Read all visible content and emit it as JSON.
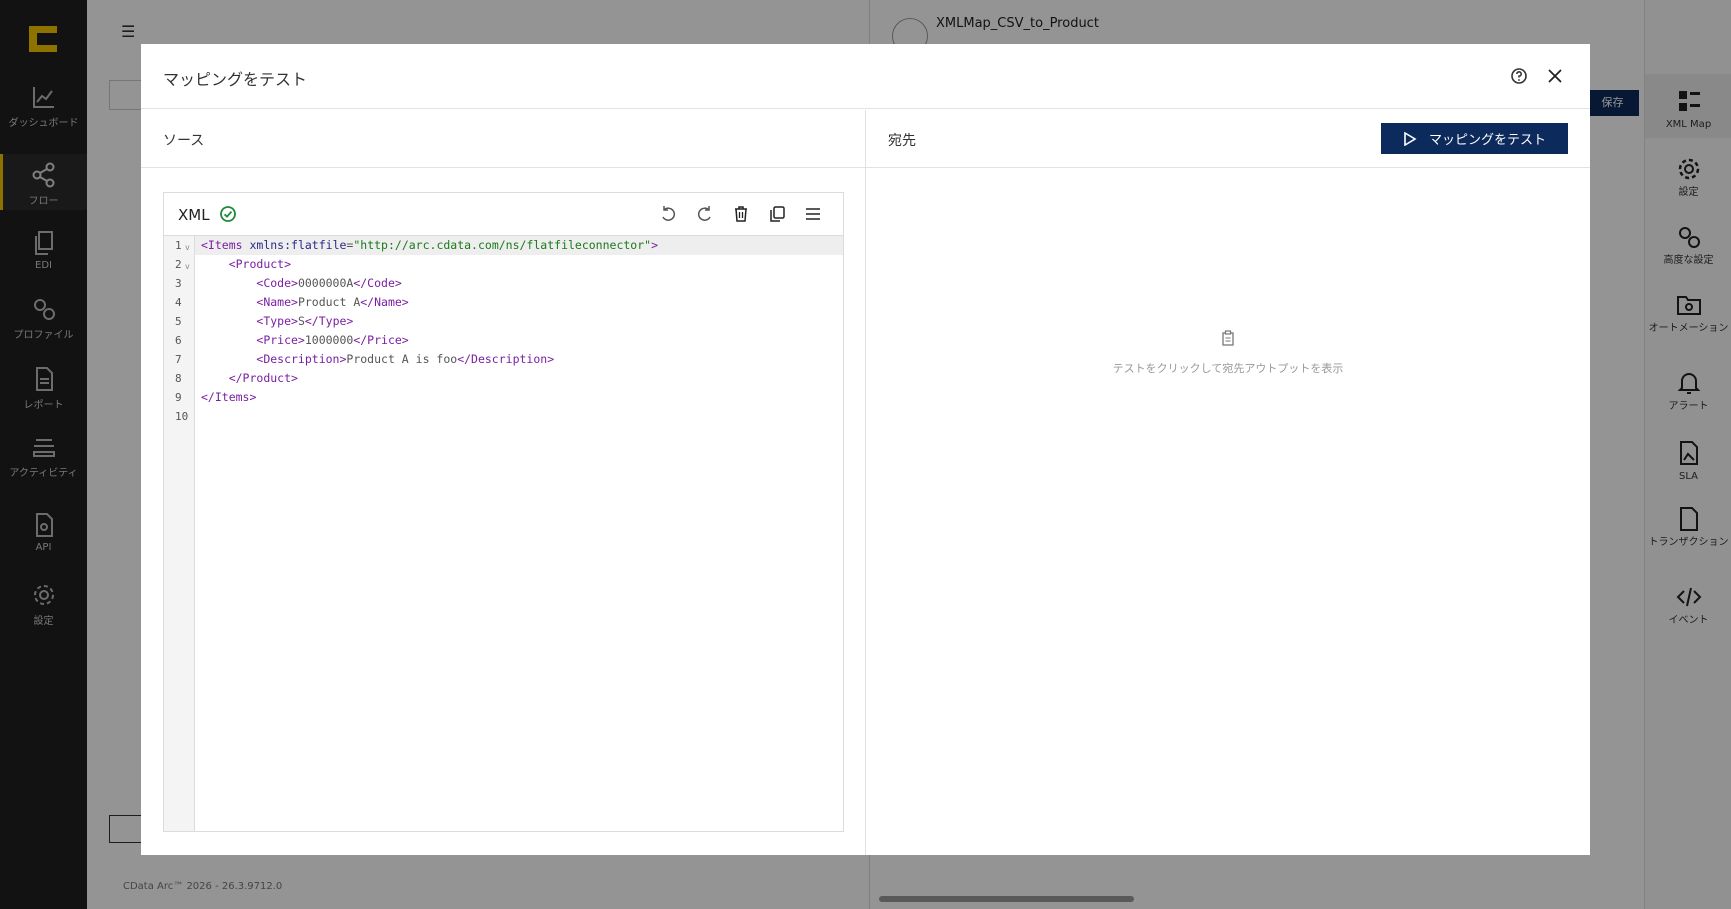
{
  "leftnav": {
    "items": [
      {
        "label": "ダッシュボード",
        "icon": "chart-icon"
      },
      {
        "label": "フロー",
        "icon": "share-icon"
      },
      {
        "label": "EDI",
        "icon": "documents-icon"
      },
      {
        "label": "プロファイル",
        "icon": "gears-icon"
      },
      {
        "label": "レポート",
        "icon": "report-icon"
      },
      {
        "label": "アクティビティ",
        "icon": "stack-icon"
      },
      {
        "label": "API",
        "icon": "api-icon"
      },
      {
        "label": "設定",
        "icon": "gear-icon"
      }
    ]
  },
  "background": {
    "flow_title": "XMLMap_CSV_to_Product",
    "save_label": "保存",
    "footer_version": "CData Arc™ 2026 - 26.3.9712.0"
  },
  "rightrail": {
    "items": [
      {
        "label": "XML Map",
        "icon": "grid-icon"
      },
      {
        "label": "設定",
        "icon": "gear-icon"
      },
      {
        "label": "高度な設定",
        "icon": "gears-icon"
      },
      {
        "label": "オートメーション",
        "icon": "folder-gear-icon"
      },
      {
        "label": "アラート",
        "icon": "bell-icon"
      },
      {
        "label": "SLA",
        "icon": "image-doc-icon"
      },
      {
        "label": "トランザクション",
        "icon": "file-icon"
      },
      {
        "label": "イベント",
        "icon": "code-icon"
      }
    ]
  },
  "modal": {
    "title": "マッピングをテスト",
    "source_label": "ソース",
    "dest_label": "宛先",
    "test_button": "マッピングをテスト",
    "editor": {
      "language": "XML",
      "status": "valid",
      "lines": [
        {
          "n": "1",
          "fold": true
        },
        {
          "n": "2",
          "fold": true
        },
        {
          "n": "3"
        },
        {
          "n": "4"
        },
        {
          "n": "5"
        },
        {
          "n": "6"
        },
        {
          "n": "7"
        },
        {
          "n": "8"
        },
        {
          "n": "9"
        },
        {
          "n": "10"
        }
      ],
      "code": {
        "l1_open": "<Items",
        "l1_attr": "xmlns:flatfile",
        "l1_eq": "=",
        "l1_val": "\"http://arc.cdata.com/ns/flatfileconnector\"",
        "l1_close": ">",
        "l2": "<Product>",
        "l3_o": "<Code>",
        "l3_t": "0000000A",
        "l3_c": "</Code>",
        "l4_o": "<Name>",
        "l4_t": "Product A",
        "l4_c": "</Name>",
        "l5_o": "<Type>",
        "l5_t": "S",
        "l5_c": "</Type>",
        "l6_o": "<Price>",
        "l6_t": "1000000",
        "l6_c": "</Price>",
        "l7_o": "<Description>",
        "l7_t": "Product A is foo",
        "l7_c": "</Description>",
        "l8": "</Product>",
        "l9": "</Items>"
      }
    },
    "empty_message": "テストをクリックして宛先アウトプットを表示"
  },
  "colors": {
    "primary_button": "#0d2a5c",
    "nav_bg": "#1f1f1f",
    "accent": "#f5c400",
    "valid": "#1e8a3c"
  }
}
